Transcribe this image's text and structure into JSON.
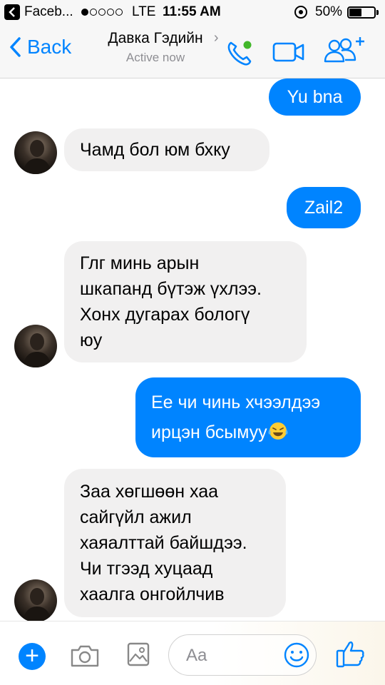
{
  "status_bar": {
    "app_label": "Faceb...",
    "signal_bars_filled": 1,
    "signal_bars_total": 5,
    "network": "LTE",
    "time": "11:55 AM",
    "battery_percent": "50%",
    "battery_level": 0.5
  },
  "header": {
    "back_label": "Back",
    "contact_name": "Давка Гэдийн",
    "contact_status": "Active now",
    "icons": [
      "phone-icon",
      "video-camera-icon",
      "add-people-icon"
    ],
    "accent_color": "#0084ff",
    "active_dot_color": "#42b72a"
  },
  "messages": [
    {
      "direction": "out",
      "text": "Yu bna"
    },
    {
      "direction": "in",
      "text": "Чамд бол юм бхку"
    },
    {
      "direction": "out",
      "text": "Zail2"
    },
    {
      "direction": "in",
      "lines": [
        "Глг минь арын",
        "шкапанд бүтэж үхлээ.",
        "Хонх дугарах бологү",
        "юу"
      ]
    },
    {
      "direction": "out",
      "lines": [
        "Ее чи чинь хчээлдээ",
        "ирцэн бсымуу"
      ],
      "emoji": "laughing-tears-emoji"
    },
    {
      "direction": "in",
      "lines": [
        "Заа хөгшөөн хаа",
        "сайгүйл ажил",
        "хаяалттай байшдээ.",
        "Чи тгээд хуцаад",
        "хаалга онгойлчив"
      ]
    }
  ],
  "composer": {
    "plus_label": "+",
    "input_placeholder": "Aa",
    "icons": [
      "plus-icon",
      "camera-icon",
      "photo-icon",
      "emoji-icon",
      "thumbs-up-icon"
    ]
  },
  "colors": {
    "outgoing_bubble": "#0084ff",
    "incoming_bubble": "#f1f0f0",
    "header_bg": "#f7f7f7"
  }
}
